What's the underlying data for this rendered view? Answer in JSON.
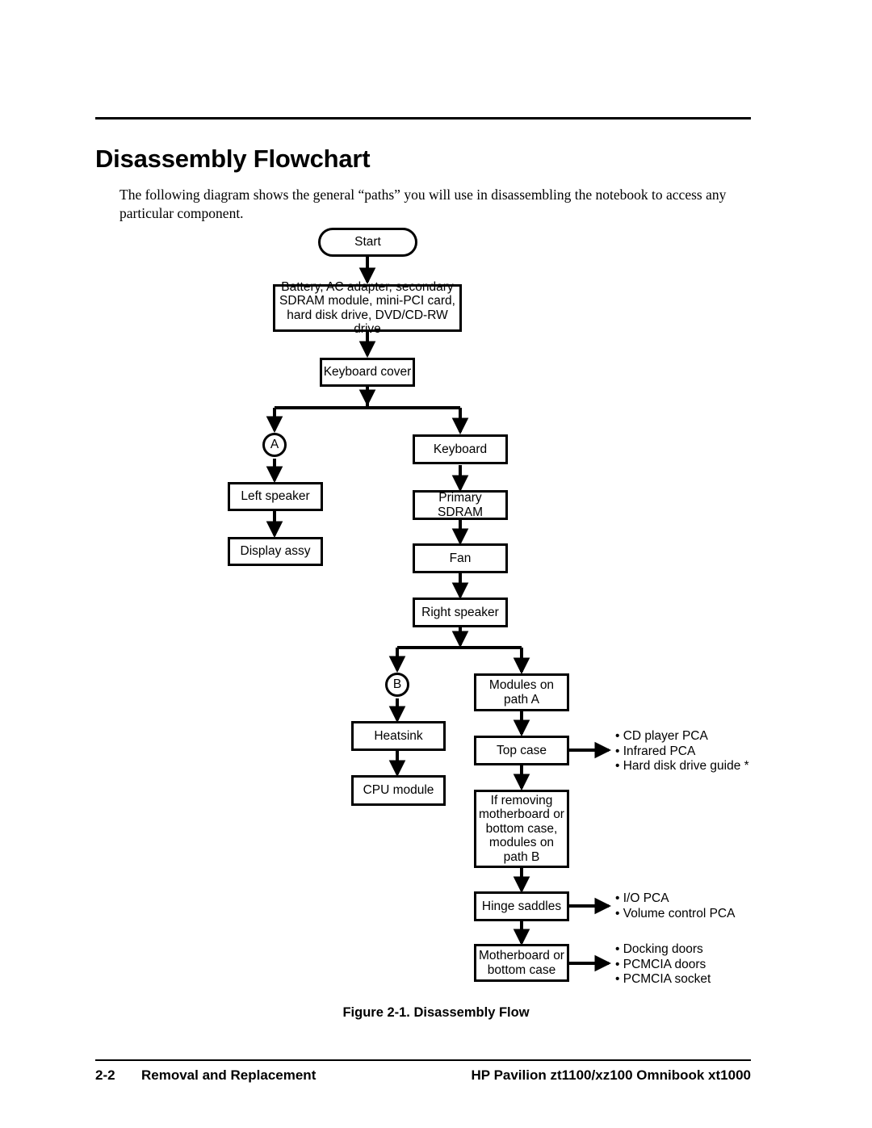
{
  "page": {
    "title": "Disassembly Flowchart",
    "intro": "The following diagram shows the general “paths” you will use in disassembling the notebook to access any particular component.",
    "figure_caption": "Figure 2-1. Disassembly Flow"
  },
  "footer": {
    "page_number": "2-2",
    "section": "Removal and Replacement",
    "product": "HP Pavilion zt1100/xz100 Omnibook xt1000"
  },
  "chart_data": {
    "type": "diagram",
    "title": "Figure 2-1. Disassembly Flow",
    "nodes": [
      {
        "id": "start",
        "label": "Start",
        "shape": "terminal"
      },
      {
        "id": "battery",
        "label": "Battery, AC adapter, secondary\nSDRAM module, mini-PCI card,\nhard disk drive, DVD/CD-RW drive",
        "shape": "box"
      },
      {
        "id": "kbdcover",
        "label": "Keyboard cover",
        "shape": "box"
      },
      {
        "id": "connA",
        "label": "A",
        "shape": "connector"
      },
      {
        "id": "leftspeaker",
        "label": "Left speaker",
        "shape": "box"
      },
      {
        "id": "displayassy",
        "label": "Display assy",
        "shape": "box"
      },
      {
        "id": "keyboard",
        "label": "Keyboard",
        "shape": "box"
      },
      {
        "id": "primsdram",
        "label": "Primary SDRAM",
        "shape": "box"
      },
      {
        "id": "fan",
        "label": "Fan",
        "shape": "box"
      },
      {
        "id": "rightspeaker",
        "label": "Right speaker",
        "shape": "box"
      },
      {
        "id": "connB",
        "label": "B",
        "shape": "connector"
      },
      {
        "id": "heatsink",
        "label": "Heatsink",
        "shape": "box"
      },
      {
        "id": "cpumodule",
        "label": "CPU module",
        "shape": "box"
      },
      {
        "id": "modpathA",
        "label": "Modules on\npath A",
        "shape": "box"
      },
      {
        "id": "topcase",
        "label": "Top case",
        "shape": "box"
      },
      {
        "id": "ifremoving",
        "label": "If removing\nmotherboard or\nbottom case,\nmodules on\npath B",
        "shape": "box"
      },
      {
        "id": "hinge",
        "label": "Hinge saddles",
        "shape": "box"
      },
      {
        "id": "mobo",
        "label": "Motherboard or\nbottom case",
        "shape": "box"
      }
    ],
    "edges": [
      {
        "from": "start",
        "to": "battery"
      },
      {
        "from": "battery",
        "to": "kbdcover"
      },
      {
        "from": "kbdcover",
        "to": "connA"
      },
      {
        "from": "kbdcover",
        "to": "keyboard"
      },
      {
        "from": "connA",
        "to": "leftspeaker"
      },
      {
        "from": "leftspeaker",
        "to": "displayassy"
      },
      {
        "from": "keyboard",
        "to": "primsdram"
      },
      {
        "from": "primsdram",
        "to": "fan"
      },
      {
        "from": "fan",
        "to": "rightspeaker"
      },
      {
        "from": "rightspeaker",
        "to": "connB"
      },
      {
        "from": "rightspeaker",
        "to": "modpathA"
      },
      {
        "from": "connB",
        "to": "heatsink"
      },
      {
        "from": "heatsink",
        "to": "cpumodule"
      },
      {
        "from": "modpathA",
        "to": "topcase"
      },
      {
        "from": "topcase",
        "to": "ifremoving"
      },
      {
        "from": "topcase",
        "to": "topcase_bullets"
      },
      {
        "from": "ifremoving",
        "to": "hinge"
      },
      {
        "from": "hinge",
        "to": "hinge_bullets"
      },
      {
        "from": "hinge",
        "to": "mobo"
      },
      {
        "from": "mobo",
        "to": "mobo_bullets"
      }
    ],
    "annotations": [
      {
        "id": "topcase_bullets",
        "source": "topcase",
        "text": "• CD player PCA\n• Infrared PCA\n• Hard disk drive guide *"
      },
      {
        "id": "hinge_bullets",
        "source": "hinge",
        "text": "• I/O PCA\n• Volume control PCA"
      },
      {
        "id": "mobo_bullets",
        "source": "mobo",
        "text": "• Docking doors\n• PCMCIA doors\n• PCMCIA socket"
      }
    ]
  }
}
